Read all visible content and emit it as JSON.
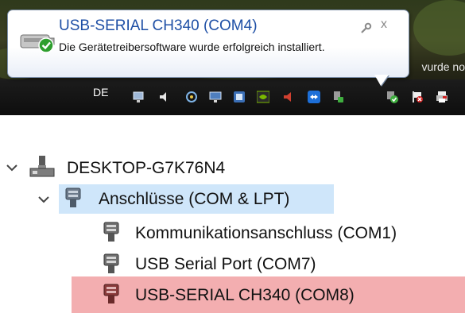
{
  "notification": {
    "title": "USB-SERIAL CH340 (COM4)",
    "message": "Die Gerätetreibersoftware wurde erfolgreich installiert.",
    "close_glyph": "x",
    "device_icon": "usb-device-icon",
    "success_icon": "green-check-icon"
  },
  "taskbar": {
    "language": "DE",
    "background_text": "vurde no",
    "tray_icons": [
      "network-icon",
      "speaker-icon",
      "sync-icon",
      "display-icon",
      "update-icon",
      "nvidia-icon",
      "volume-icon",
      "teamviewer-icon",
      "device-install-icon",
      "device-success-icon",
      "flag-icon",
      "printer-icon"
    ]
  },
  "device_manager": {
    "computer_name": "DESKTOP-G7K76N4",
    "category": "Anschlüsse (COM & LPT)",
    "ports": [
      {
        "label": "Kommunikationsanschluss (COM1)",
        "highlighted": false
      },
      {
        "label": "USB Serial Port (COM7)",
        "highlighted": false
      },
      {
        "label": "USB-SERIAL CH340 (COM8)",
        "highlighted": true
      }
    ],
    "colors": {
      "selection": "#cfe6fa",
      "highlight": "#f3aeb0",
      "title_blue": "#1e4fa5"
    }
  }
}
